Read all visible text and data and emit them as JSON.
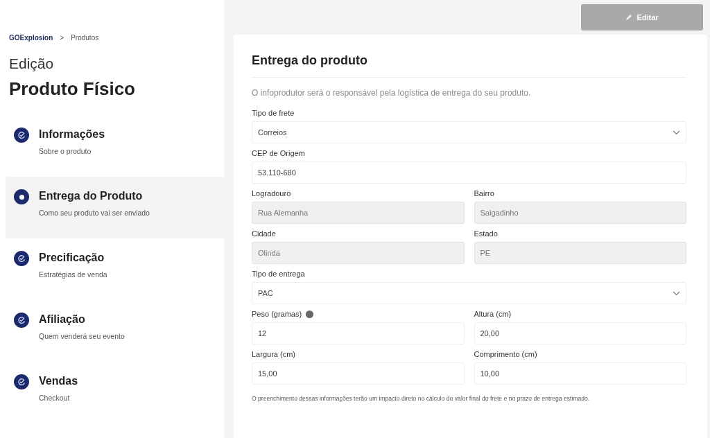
{
  "breadcrumb": {
    "root": "GOExplosion",
    "separator": ">",
    "current": "Produtos"
  },
  "heading": {
    "overline": "Edição",
    "title": "Produto Físico"
  },
  "steps": [
    {
      "title": "Informações",
      "subtitle": "Sobre o produto",
      "selected": false
    },
    {
      "title": "Entrega do Produto",
      "subtitle": "Como seu produto vai ser enviado",
      "selected": true
    },
    {
      "title": "Precificação",
      "subtitle": "Estratégias de venda",
      "selected": false
    },
    {
      "title": "Afiliação",
      "subtitle": "Quem venderá seu evento",
      "selected": false
    },
    {
      "title": "Vendas",
      "subtitle": "Checkout",
      "selected": false
    }
  ],
  "edit_button": {
    "label": "Editar",
    "disabled": true
  },
  "form": {
    "title": "Entrega do produto",
    "description": "O infoprodutor será o responsável pela logística de entrega do seu produto.",
    "rows": [
      [
        {
          "label": "Tipo de frete",
          "value": "Correios",
          "kind": "select",
          "disabled": false
        }
      ],
      [
        {
          "label": "CEP de Origem",
          "value": "53.110-680",
          "kind": "text",
          "disabled": false
        }
      ],
      [
        {
          "label": "Logradouro",
          "value": "Rua Alemanha",
          "kind": "text",
          "disabled": true
        },
        {
          "label": "Bairro",
          "value": "Salgadinho",
          "kind": "text",
          "disabled": true
        }
      ],
      [
        {
          "label": "Cidade",
          "value": "Olinda",
          "kind": "text",
          "disabled": true
        },
        {
          "label": "Estado",
          "value": "PE",
          "kind": "text",
          "disabled": true
        }
      ],
      [
        {
          "label": "Tipo de entrega",
          "value": "PAC",
          "kind": "select",
          "disabled": false
        }
      ],
      [
        {
          "label": "Peso (gramas)",
          "value": "12",
          "kind": "text",
          "disabled": false,
          "info": true
        },
        {
          "label": "Altura (cm)",
          "value": "20,00",
          "kind": "text",
          "disabled": false
        }
      ],
      [
        {
          "label": "Largura (cm)",
          "value": "15,00",
          "kind": "text",
          "disabled": false
        },
        {
          "label": "Comprimento (cm)",
          "value": "10,00",
          "kind": "text",
          "disabled": false
        }
      ]
    ],
    "footnote": "O preenchimento dessas informações terão um impacto direto no cálculo do valor final do frete e no prazo de entrega estimado."
  }
}
